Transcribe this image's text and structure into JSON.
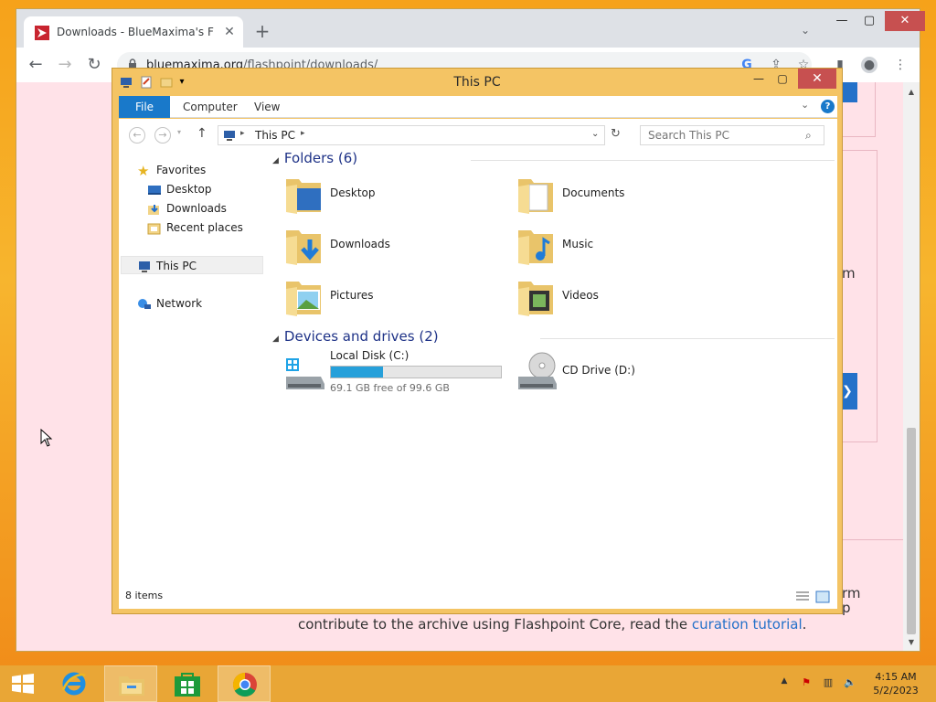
{
  "browser": {
    "tab_title": "Downloads - BlueMaxima's Flashpoint",
    "tab_close": "✕",
    "new_tab": "+",
    "url_host": "bluemaxima.org",
    "url_path": "/flashpoint/downloads/",
    "window_controls": {
      "minimize": "—",
      "maximize": "▢",
      "close": "✕"
    }
  },
  "webpage": {
    "frag_m": "m",
    "frag_rm": "rm",
    "frag_p": "p",
    "bottom_line_prefix": "contribute to the archive using Flashpoint Core, read the ",
    "bottom_link": "curation tutorial",
    "bottom_line_suffix": ".",
    "side_btn_arrow": "❯"
  },
  "explorer": {
    "title": "This PC",
    "ribbon_tabs": [
      "File",
      "Computer",
      "View"
    ],
    "help": "?",
    "address_location": "This PC",
    "search_placeholder": "Search This PC",
    "nav": {
      "favorites": "Favorites",
      "desktop": "Desktop",
      "downloads": "Downloads",
      "recent": "Recent places",
      "this_pc": "This PC",
      "network": "Network"
    },
    "folders_header": "Folders (6)",
    "folders": [
      "Desktop",
      "Documents",
      "Downloads",
      "Music",
      "Pictures",
      "Videos"
    ],
    "devices_header": "Devices and drives (2)",
    "drives": [
      {
        "name": "Local Disk (C:)",
        "free": "69.1 GB free of 99.6 GB",
        "used_fraction": 0.306
      },
      {
        "name": "CD Drive (D:)"
      }
    ],
    "status": "8 items"
  },
  "taskbar": {
    "time": "4:15 AM",
    "date": "5/2/2023"
  },
  "colors": {
    "accent": "#1979ca",
    "drive_fill": "#26a0da",
    "explorer_frame": "#f4c464",
    "webpage_bg": "#ffe2e8"
  }
}
